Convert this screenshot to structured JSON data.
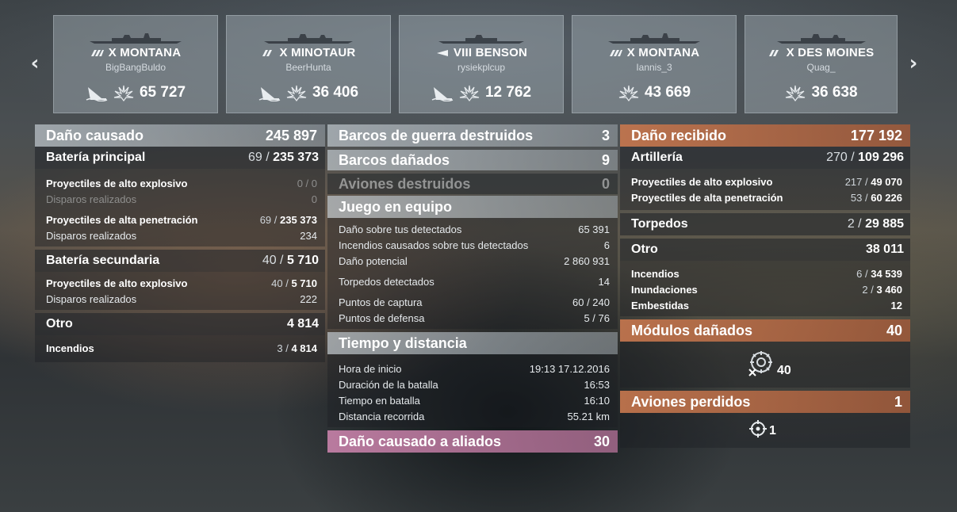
{
  "nav": {
    "prev_icon": "chevron-left-icon",
    "next_icon": "chevron-right-icon",
    "prev": "‹",
    "next": "›"
  },
  "ships": [
    {
      "tier_name": "X MONTANA",
      "player": "BigBangBuldo",
      "damage": "65 727",
      "class": "battleship",
      "ribbons": [
        "ship-sunk-icon",
        "damage-ribbon-icon"
      ]
    },
    {
      "tier_name": "X MINOTAUR",
      "player": "BeerHunta",
      "damage": "36 406",
      "class": "cruiser",
      "ribbons": [
        "ship-sunk-icon",
        "damage-ribbon-icon"
      ]
    },
    {
      "tier_name": "VIII BENSON",
      "player": "rysiekplcup",
      "damage": "12 762",
      "class": "destroyer",
      "ribbons": [
        "ship-sunk-icon",
        "damage-ribbon-icon"
      ]
    },
    {
      "tier_name": "X MONTANA",
      "player": "Iannis_3",
      "damage": "43 669",
      "class": "battleship",
      "ribbons": [
        "damage-ribbon-icon"
      ]
    },
    {
      "tier_name": "X DES MOINES",
      "player": "Quag_",
      "damage": "36 638",
      "class": "cruiser",
      "ribbons": [
        "damage-ribbon-icon"
      ]
    }
  ],
  "damage_dealt": {
    "title": "Daño causado",
    "total": "245 897",
    "main_battery": {
      "label": "Batería principal",
      "hits": "69",
      "dmg": "235 373"
    },
    "he": {
      "label": "Proyectiles de alto explosivo",
      "hits": "0",
      "dmg": "0",
      "shots_label": "Disparos realizados",
      "shots": "0"
    },
    "ap": {
      "label": "Proyectiles de alta penetración",
      "hits": "69",
      "dmg": "235 373",
      "shots_label": "Disparos realizados",
      "shots": "234"
    },
    "secondary": {
      "label": "Batería secundaria",
      "hits": "40",
      "dmg": "5 710"
    },
    "sec_he": {
      "label": "Proyectiles de alto explosivo",
      "hits": "40",
      "dmg": "5 710",
      "shots_label": "Disparos realizados",
      "shots": "222"
    },
    "other": {
      "label": "Otro",
      "dmg": "4 814"
    },
    "fires": {
      "label": "Incendios",
      "hits": "3",
      "dmg": "4 814"
    }
  },
  "middle": {
    "destroyed": {
      "label": "Barcos de guerra destruidos",
      "value": "3"
    },
    "damaged": {
      "label": "Barcos dañados",
      "value": "9"
    },
    "planes": {
      "label": "Aviones destruidos",
      "value": "0"
    },
    "teamplay": {
      "title": "Juego en equipo",
      "rows": [
        {
          "label": "Daño sobre tus detectados",
          "value": "65 391"
        },
        {
          "label": "Incendios causados sobre tus detectados",
          "value": "6"
        },
        {
          "label": "Daño potencial",
          "value": "2 860 931"
        },
        {
          "label": "Torpedos detectados",
          "value": "14"
        },
        {
          "label": "Puntos de captura",
          "value": "60 / 240"
        },
        {
          "label": "Puntos de defensa",
          "value": "5 / 76"
        }
      ]
    },
    "time": {
      "title": "Tiempo y distancia",
      "rows": [
        {
          "label": "Hora de inicio",
          "value": "19:13  17.12.2016"
        },
        {
          "label": "Duración de la batalla",
          "value": "16:53"
        },
        {
          "label": "Tiempo en batalla",
          "value": "16:10"
        },
        {
          "label": "Distancia recorrida",
          "value": "55.21 km"
        }
      ]
    },
    "allied": {
      "label": "Daño causado a aliados",
      "value": "30"
    }
  },
  "received": {
    "title": "Daño recibido",
    "total": "177 192",
    "artillery": {
      "label": "Artillería",
      "hits": "270",
      "dmg": "109 296"
    },
    "he": {
      "label": "Proyectiles de alto explosivo",
      "hits": "217",
      "dmg": "49 070"
    },
    "ap": {
      "label": "Proyectiles de alta penetración",
      "hits": "53",
      "dmg": "60 226"
    },
    "torpedoes": {
      "label": "Torpedos",
      "hits": "2",
      "dmg": "29 885"
    },
    "other": {
      "label": "Otro",
      "dmg": "38 011"
    },
    "fires": {
      "label": "Incendios",
      "hits": "6",
      "dmg": "34 539"
    },
    "floods": {
      "label": "Inundaciones",
      "hits": "2",
      "dmg": "3 460"
    },
    "rams": {
      "label": "Embestidas",
      "dmg": "12"
    },
    "modules": {
      "label": "Módulos dañados",
      "value": "40",
      "icon": "damaged-module-icon",
      "count": "40"
    },
    "planes_lost": {
      "label": "Aviones perdidos",
      "value": "1",
      "icon": "crosshair-icon",
      "count": "1"
    }
  },
  "colors": {
    "orange_header": "#c4764e",
    "pink_header": "#c882aa",
    "grey_header": "#bec6cc"
  }
}
